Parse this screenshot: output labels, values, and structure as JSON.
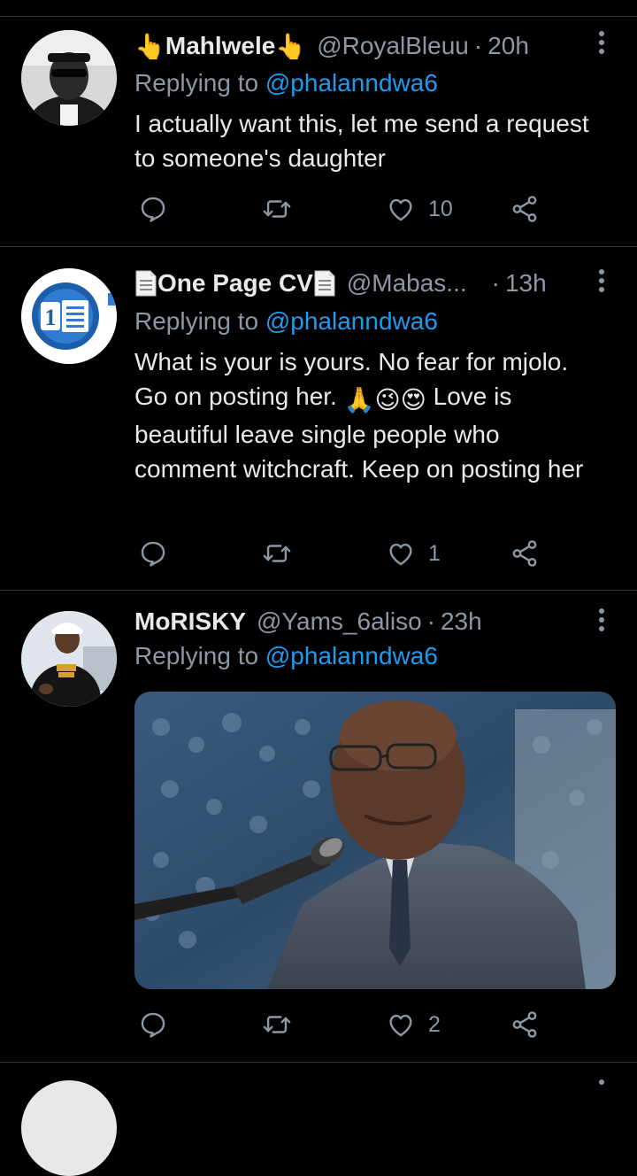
{
  "tweets": [
    {
      "name": "Mahlwele",
      "name_prefix_emoji": "👆",
      "name_suffix_emoji": "👆",
      "handle": "@RoyalBleuu",
      "time": "20h",
      "replying_label": "Replying to",
      "replying_to": "@phalanndwa6",
      "text": "I actually want this, let me send a request to someone's daughter",
      "reply_count": "",
      "retweet_count": "",
      "like_count": "10"
    },
    {
      "name": "One Page CV",
      "name_icon": "document-icon",
      "handle": "@Mabas...",
      "time": "13h",
      "replying_label": "Replying to",
      "replying_to": "@phalanndwa6",
      "text_part1": "What is your is yours. No fear for mjolo. Go on posting her.",
      "text_emojis": "🙏😉😍",
      "text_part2": "Love is beautiful leave single people who comment witchcraft. Keep on posting her",
      "reply_count": "",
      "retweet_count": "",
      "like_count": "1"
    },
    {
      "name": "MoRISKY",
      "handle": "@Yams_6aliso",
      "time": "23h",
      "replying_label": "Replying to",
      "replying_to": "@phalanndwa6",
      "media_description": "photo-man-at-microphone",
      "reply_count": "",
      "retweet_count": "",
      "like_count": "2"
    }
  ],
  "colors": {
    "background": "#000000",
    "text": "#e7e9ea",
    "secondary": "#8b98a5",
    "link": "#1d9bf0",
    "divider": "#2f3336"
  }
}
